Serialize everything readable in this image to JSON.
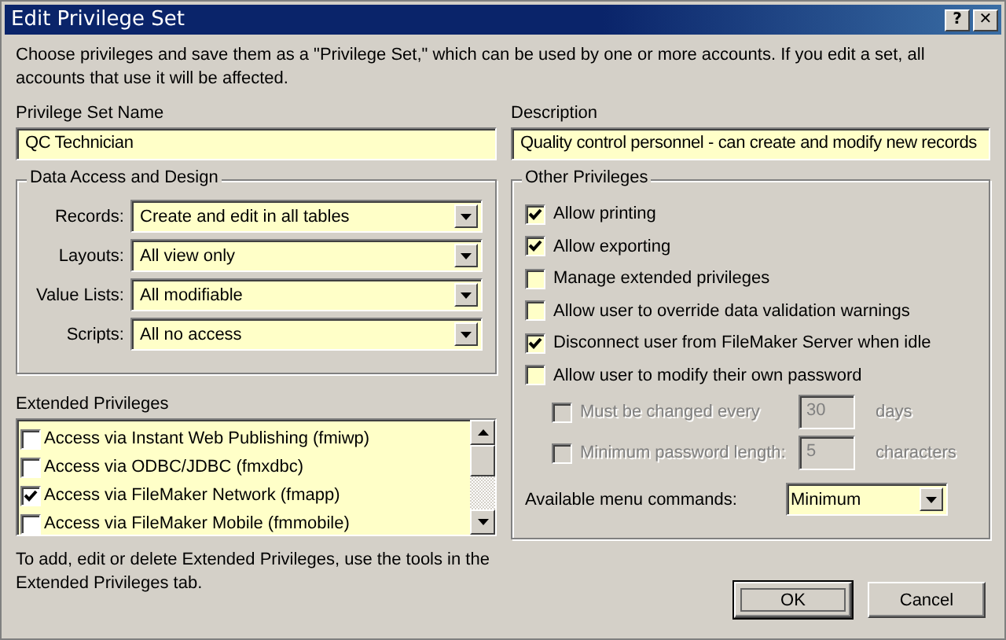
{
  "window": {
    "title": "Edit Privilege Set",
    "help_button": "?",
    "close_button": "✕"
  },
  "intro": "Choose privileges and save them as a \"Privilege Set,\" which can be used by one or more accounts. If you edit a set, all accounts that use it will be affected.",
  "name_field": {
    "label": "Privilege Set Name",
    "value": "QC Technician"
  },
  "description_field": {
    "label": "Description",
    "value": "Quality control personnel - can create and modify new records"
  },
  "data_access": {
    "title": "Data Access and Design",
    "rows": [
      {
        "label": "Records:",
        "value": "Create and edit in all tables"
      },
      {
        "label": "Layouts:",
        "value": "All view only"
      },
      {
        "label": "Value Lists:",
        "value": "All modifiable"
      },
      {
        "label": "Scripts:",
        "value": "All no access"
      }
    ]
  },
  "extended_privileges": {
    "label": "Extended Privileges",
    "items": [
      {
        "label": "Access via Instant Web Publishing (fmiwp)",
        "checked": false
      },
      {
        "label": "Access via ODBC/JDBC (fmxdbc)",
        "checked": false
      },
      {
        "label": "Access via FileMaker Network (fmapp)",
        "checked": true
      },
      {
        "label": "Access via FileMaker Mobile (fmmobile)",
        "checked": false
      }
    ],
    "note": "To add, edit or delete Extended Privileges, use the tools in the Extended Privileges tab."
  },
  "other_privileges": {
    "title": "Other Privileges",
    "items": [
      {
        "kind": "check",
        "label": "Allow printing",
        "checked": true,
        "disabled": false
      },
      {
        "kind": "check",
        "label": "Allow exporting",
        "checked": true,
        "disabled": false
      },
      {
        "kind": "check",
        "label": "Manage extended privileges",
        "checked": false,
        "disabled": false
      },
      {
        "kind": "check",
        "label": "Allow user to override data validation warnings",
        "checked": false,
        "disabled": false
      },
      {
        "kind": "check",
        "label": "Disconnect user from FileMaker Server when idle",
        "checked": true,
        "disabled": false
      },
      {
        "kind": "check",
        "label": "Allow user to modify their own password",
        "checked": false,
        "disabled": false
      },
      {
        "kind": "sub",
        "label": "Must be changed every",
        "checked": false,
        "disabled": true,
        "value": "30",
        "unit": "days"
      },
      {
        "kind": "sub",
        "label": "Minimum password length:",
        "checked": false,
        "disabled": true,
        "value": "5",
        "unit": "characters"
      }
    ],
    "menu_commands": {
      "label": "Available menu commands:",
      "value": "Minimum"
    }
  },
  "buttons": [
    {
      "label": "OK",
      "default": true
    },
    {
      "label": "Cancel",
      "default": false
    }
  ]
}
